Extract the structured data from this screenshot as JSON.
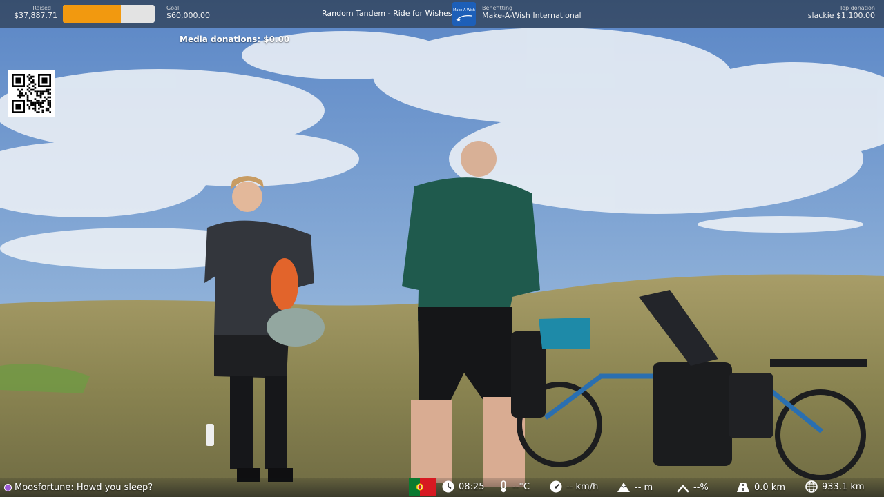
{
  "topbar": {
    "raised_label": "Raised",
    "raised_value": "$37,887.71",
    "goal_label": "Goal",
    "goal_value": "$60,000.00",
    "progress_fraction": 0.6315,
    "stream_title": "Random Tandem - Ride for Wishes",
    "benefitting_label": "Benefitting",
    "charity_name": "Make-A-Wish International",
    "charity_logo_text": "Make-A-Wish",
    "top_donation_label": "Top donation",
    "top_donation_value": "slackie $1,100.00"
  },
  "media_donations": "Media donations: $0.00",
  "chat": {
    "message": "Moosfortune: Howd you sleep?"
  },
  "stats": {
    "time": "08:25",
    "temperature": "--°C",
    "speed": "-- km/h",
    "elevation": "-- m",
    "grade": "--%",
    "trip_distance": "0.0 km",
    "total_distance": "933.1 km"
  },
  "icons": [
    "qr-code-icon",
    "chat-badge-icon",
    "portugal-flag-icon",
    "clock-icon",
    "thermometer-icon",
    "speedometer-icon",
    "mountain-icon",
    "incline-icon",
    "road-icon",
    "globe-icon"
  ],
  "colors": {
    "progress": "#f2990f",
    "progress_track": "#e3e3e3",
    "charity_blue": "#1d5fb8"
  }
}
